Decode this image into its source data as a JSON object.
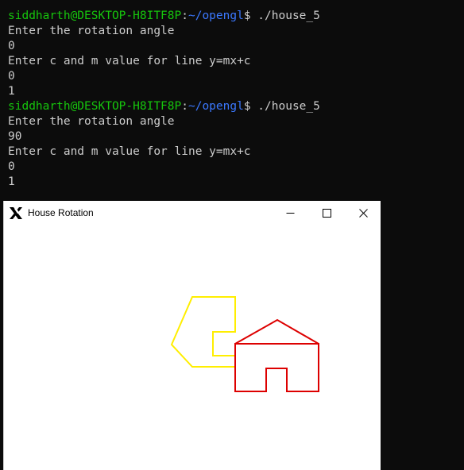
{
  "terminal": {
    "lines": [
      {
        "kind": "prompt",
        "user": "siddharth@DESKTOP-H8ITF8P",
        "sep": ":",
        "path": "~/opengl",
        "dollar": "$",
        "command": " ./house_5"
      },
      {
        "kind": "text",
        "text": "Enter the rotation angle"
      },
      {
        "kind": "text",
        "text": "0"
      },
      {
        "kind": "text",
        "text": "Enter c and m value for line y=mx+c"
      },
      {
        "kind": "text",
        "text": "0"
      },
      {
        "kind": "text",
        "text": "1"
      },
      {
        "kind": "prompt",
        "user": "siddharth@DESKTOP-H8ITF8P",
        "sep": ":",
        "path": "~/opengl",
        "dollar": "$",
        "command": " ./house_5"
      },
      {
        "kind": "text",
        "text": "Enter the rotation angle"
      },
      {
        "kind": "text",
        "text": "90"
      },
      {
        "kind": "text",
        "text": "Enter c and m value for line y=mx+c"
      },
      {
        "kind": "text",
        "text": "0"
      },
      {
        "kind": "text",
        "text": "1"
      }
    ],
    "colors": {
      "background": "#0c0c0c",
      "text": "#cccccc",
      "user": "#16c60c",
      "path": "#3b78ff"
    }
  },
  "window": {
    "title": "House Rotation",
    "icon": "x-icon",
    "buttons": {
      "minimize": "minimize-icon",
      "maximize": "maximize-icon",
      "close": "close-icon"
    }
  },
  "drawing": {
    "shapes": [
      {
        "name": "original-house",
        "color": "#dd0000"
      },
      {
        "name": "rotated-house",
        "color": "#ffee00"
      }
    ]
  }
}
